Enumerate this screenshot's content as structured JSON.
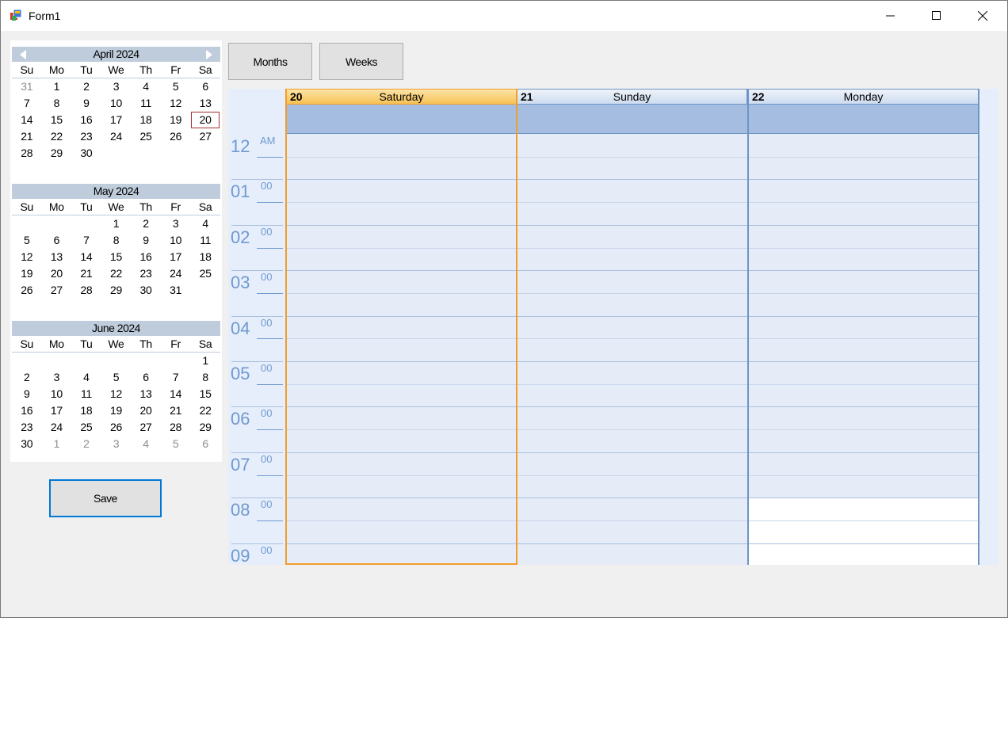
{
  "window": {
    "title": "Form1"
  },
  "calendar": {
    "months": [
      {
        "title": "April 2024",
        "days_of_week": [
          "Su",
          "Mo",
          "Tu",
          "We",
          "Th",
          "Fr",
          "Sa"
        ],
        "weeks": [
          [
            "31",
            "1",
            "2",
            "3",
            "4",
            "5",
            "6"
          ],
          [
            "7",
            "8",
            "9",
            "10",
            "11",
            "12",
            "13"
          ],
          [
            "14",
            "15",
            "16",
            "17",
            "18",
            "19",
            "20"
          ],
          [
            "21",
            "22",
            "23",
            "24",
            "25",
            "26",
            "27"
          ],
          [
            "28",
            "29",
            "30",
            "",
            "",
            "",
            ""
          ]
        ],
        "other": [
          [
            true,
            false,
            false,
            false,
            false,
            false,
            false
          ]
        ],
        "today": [
          2,
          6
        ]
      },
      {
        "title": "May 2024",
        "days_of_week": [
          "Su",
          "Mo",
          "Tu",
          "We",
          "Th",
          "Fr",
          "Sa"
        ],
        "weeks": [
          [
            "",
            "",
            "",
            "1",
            "2",
            "3",
            "4"
          ],
          [
            "5",
            "6",
            "7",
            "8",
            "9",
            "10",
            "11"
          ],
          [
            "12",
            "13",
            "14",
            "15",
            "16",
            "17",
            "18"
          ],
          [
            "19",
            "20",
            "21",
            "22",
            "23",
            "24",
            "25"
          ],
          [
            "26",
            "27",
            "28",
            "29",
            "30",
            "31",
            ""
          ]
        ]
      },
      {
        "title": "June 2024",
        "days_of_week": [
          "Su",
          "Mo",
          "Tu",
          "We",
          "Th",
          "Fr",
          "Sa"
        ],
        "weeks": [
          [
            "",
            "",
            "",
            "",
            "",
            "",
            "1"
          ],
          [
            "2",
            "3",
            "4",
            "5",
            "6",
            "7",
            "8"
          ],
          [
            "9",
            "10",
            "11",
            "12",
            "13",
            "14",
            "15"
          ],
          [
            "16",
            "17",
            "18",
            "19",
            "20",
            "21",
            "22"
          ],
          [
            "23",
            "24",
            "25",
            "26",
            "27",
            "28",
            "29"
          ],
          [
            "30",
            "1",
            "2",
            "3",
            "4",
            "5",
            "6"
          ]
        ],
        "other": [
          [],
          [],
          [],
          [],
          [],
          [
            false,
            true,
            true,
            true,
            true,
            true,
            true
          ]
        ]
      }
    ]
  },
  "buttons": {
    "months": "Months",
    "weeks": "Weeks",
    "save": "Save"
  },
  "dayview": {
    "days": [
      {
        "num": "20",
        "name": "Saturday",
        "selected": true
      },
      {
        "num": "21",
        "name": "Sunday",
        "selected": false
      },
      {
        "num": "22",
        "name": "Monday",
        "selected": false
      }
    ],
    "hours": [
      {
        "hour": "12",
        "min": "AM"
      },
      {
        "hour": "01",
        "min": "00"
      },
      {
        "hour": "02",
        "min": "00"
      },
      {
        "hour": "03",
        "min": "00"
      },
      {
        "hour": "04",
        "min": "00"
      },
      {
        "hour": "05",
        "min": "00"
      },
      {
        "hour": "06",
        "min": "00"
      },
      {
        "hour": "07",
        "min": "00"
      },
      {
        "hour": "08",
        "min": "00"
      },
      {
        "hour": "09",
        "min": "00"
      }
    ],
    "colors": {
      "border": "#6d95c4",
      "selected_border": "#f29d2a",
      "time_text": "#6f9ad0"
    }
  }
}
